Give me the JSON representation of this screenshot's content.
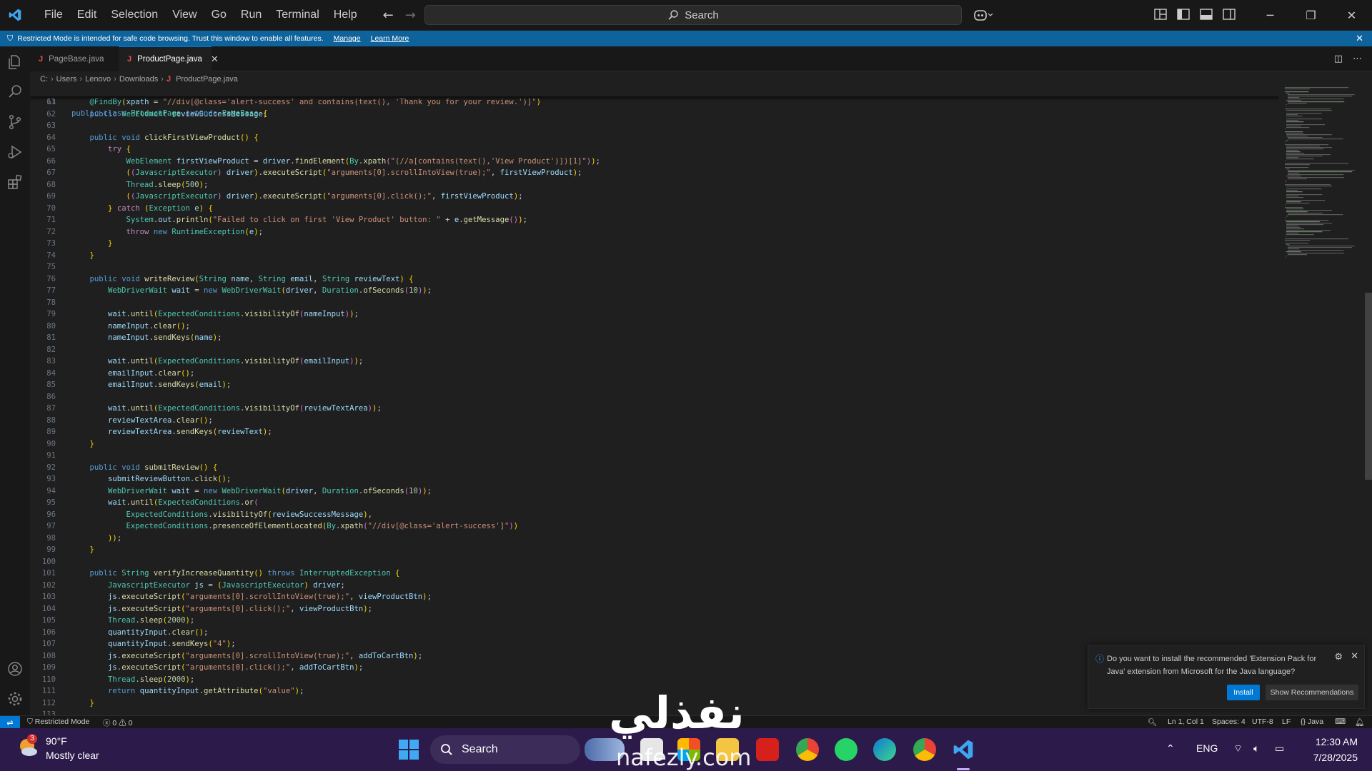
{
  "menu": [
    "File",
    "Edit",
    "Selection",
    "View",
    "Go",
    "Run",
    "Terminal",
    "Help"
  ],
  "search": {
    "label": "Search"
  },
  "banner": {
    "text": "Restricted Mode is intended for safe code browsing. Trust this window to enable all features.",
    "manage": "Manage",
    "learn_more": "Learn More"
  },
  "tabs": [
    {
      "icon": "J",
      "label": "PageBase.java"
    },
    {
      "icon": "J",
      "label": "ProductPage.java"
    }
  ],
  "breadcrumb": [
    "C:",
    "Users",
    "Lenovo",
    "Downloads",
    "ProductPage.java"
  ],
  "breadcrumb_icon": "J",
  "sticky_line": {
    "num": "13",
    "code": "public class ProductPage extends PageBase {"
  },
  "code_lines": [
    {
      "num": "61",
      "code": "    @FindBy(xpath = \"//div[@class='alert-success' and contains(text(), 'Thank you for your review.')]\")"
    },
    {
      "num": "62",
      "code": "    public WebElement reviewSuccessMessage;"
    },
    {
      "num": "63",
      "code": ""
    },
    {
      "num": "64",
      "code": "    public void clickFirstViewProduct() {"
    },
    {
      "num": "65",
      "code": "        try {"
    },
    {
      "num": "66",
      "code": "            WebElement firstViewProduct = driver.findElement(By.xpath(\"(//a[contains(text(),'View Product')])[1]\"));"
    },
    {
      "num": "67",
      "code": "            ((JavascriptExecutor) driver).executeScript(\"arguments[0].scrollIntoView(true);\", firstViewProduct);"
    },
    {
      "num": "68",
      "code": "            Thread.sleep(500);"
    },
    {
      "num": "69",
      "code": "            ((JavascriptExecutor) driver).executeScript(\"arguments[0].click();\", firstViewProduct);"
    },
    {
      "num": "70",
      "code": "        } catch (Exception e) {"
    },
    {
      "num": "71",
      "code": "            System.out.println(\"Failed to click on first 'View Product' button: \" + e.getMessage());"
    },
    {
      "num": "72",
      "code": "            throw new RuntimeException(e);"
    },
    {
      "num": "73",
      "code": "        }"
    },
    {
      "num": "74",
      "code": "    }"
    },
    {
      "num": "75",
      "code": ""
    },
    {
      "num": "76",
      "code": "    public void writeReview(String name, String email, String reviewText) {"
    },
    {
      "num": "77",
      "code": "        WebDriverWait wait = new WebDriverWait(driver, Duration.ofSeconds(10));"
    },
    {
      "num": "78",
      "code": ""
    },
    {
      "num": "79",
      "code": "        wait.until(ExpectedConditions.visibilityOf(nameInput));"
    },
    {
      "num": "80",
      "code": "        nameInput.clear();"
    },
    {
      "num": "81",
      "code": "        nameInput.sendKeys(name);"
    },
    {
      "num": "82",
      "code": ""
    },
    {
      "num": "83",
      "code": "        wait.until(ExpectedConditions.visibilityOf(emailInput));"
    },
    {
      "num": "84",
      "code": "        emailInput.clear();"
    },
    {
      "num": "85",
      "code": "        emailInput.sendKeys(email);"
    },
    {
      "num": "86",
      "code": ""
    },
    {
      "num": "87",
      "code": "        wait.until(ExpectedConditions.visibilityOf(reviewTextArea));"
    },
    {
      "num": "88",
      "code": "        reviewTextArea.clear();"
    },
    {
      "num": "89",
      "code": "        reviewTextArea.sendKeys(reviewText);"
    },
    {
      "num": "90",
      "code": "    }"
    },
    {
      "num": "91",
      "code": ""
    },
    {
      "num": "92",
      "code": "    public void submitReview() {"
    },
    {
      "num": "93",
      "code": "        submitReviewButton.click();"
    },
    {
      "num": "94",
      "code": "        WebDriverWait wait = new WebDriverWait(driver, Duration.ofSeconds(10));"
    },
    {
      "num": "95",
      "code": "        wait.until(ExpectedConditions.or("
    },
    {
      "num": "96",
      "code": "            ExpectedConditions.visibilityOf(reviewSuccessMessage),"
    },
    {
      "num": "97",
      "code": "            ExpectedConditions.presenceOfElementLocated(By.xpath(\"//div[@class='alert-success']\"))"
    },
    {
      "num": "98",
      "code": "        ));"
    },
    {
      "num": "99",
      "code": "    }"
    },
    {
      "num": "100",
      "code": ""
    },
    {
      "num": "101",
      "code": "    public String verifyIncreaseQuantity() throws InterruptedException {"
    },
    {
      "num": "102",
      "code": "        JavascriptExecutor js = (JavascriptExecutor) driver;"
    },
    {
      "num": "103",
      "code": "        js.executeScript(\"arguments[0].scrollIntoView(true);\", viewProductBtn);"
    },
    {
      "num": "104",
      "code": "        js.executeScript(\"arguments[0].click();\", viewProductBtn);"
    },
    {
      "num": "105",
      "code": "        Thread.sleep(2000);"
    },
    {
      "num": "106",
      "code": "        quantityInput.clear();"
    },
    {
      "num": "107",
      "code": "        quantityInput.sendKeys(\"4\");"
    },
    {
      "num": "108",
      "code": "        js.executeScript(\"arguments[0].scrollIntoView(true);\", addToCartBtn);"
    },
    {
      "num": "109",
      "code": "        js.executeScript(\"arguments[0].click();\", addToCartBtn);"
    },
    {
      "num": "110",
      "code": "        Thread.sleep(2000);"
    },
    {
      "num": "111",
      "code": "        return quantityInput.getAttribute(\"value\");"
    },
    {
      "num": "112",
      "code": "    }"
    },
    {
      "num": "113",
      "code": ""
    }
  ],
  "notification": {
    "message": "Do you want to install the recommended 'Extension Pack for Java' extension from Microsoft for the Java language?",
    "install": "Install",
    "show_recommendations": "Show Recommendations"
  },
  "status": {
    "restricted": "Restricted Mode",
    "errors": "0",
    "warnings": "0",
    "position": "Ln 1, Col 1",
    "spaces": "Spaces: 4",
    "encoding": "UTF-8",
    "eol": "LF",
    "language": "Java"
  },
  "taskbar": {
    "temperature": "90°F",
    "weather": "Mostly clear",
    "weather_badge": "3",
    "search": "Search",
    "lang": "ENG",
    "time": "12:30 AM",
    "date": "7/28/2025"
  },
  "watermark": {
    "arabic": "نفذلي",
    "latin": "nafezly.com"
  },
  "colors": {
    "accent": "#0078d4",
    "banner": "#0e639c",
    "editor_bg": "#1f1f1f",
    "taskbar": "#2c1a4a"
  }
}
